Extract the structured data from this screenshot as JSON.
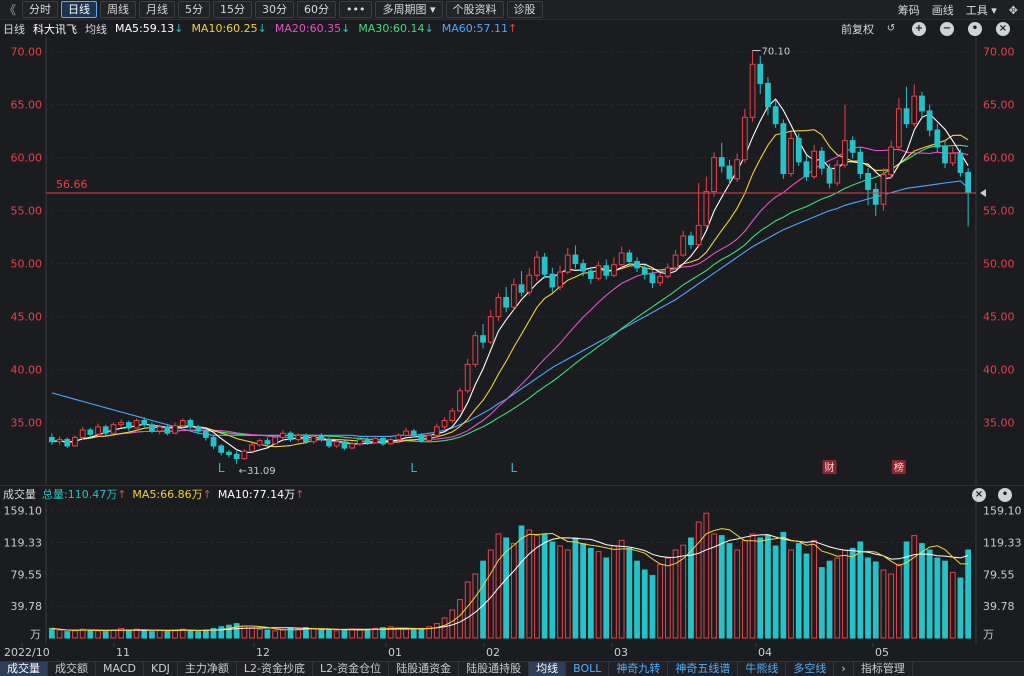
{
  "toolbar": {
    "back": "《",
    "tabs": [
      "分时",
      "日线",
      "周线",
      "月线",
      "5分",
      "15分",
      "30分",
      "60分",
      "•••",
      "多周期图 ▾",
      "个股资料",
      "诊股"
    ],
    "active_tab": 1,
    "right": [
      "筹码",
      "画线",
      "工具 ▾"
    ]
  },
  "info": {
    "period": "日线",
    "name": "科大讯飞",
    "ma_label": "均线",
    "ma5": "MA5:59.13",
    "ma10": "MA10:60.25",
    "ma20": "MA20:60.35",
    "ma30": "MA30:60.14",
    "ma60": "MA60:57.11",
    "ma5_dir": "↓",
    "ma10_dir": "↓",
    "ma20_dir": "↓",
    "ma30_dir": "↓",
    "ma60_dir": "↑",
    "adjust": "前复权"
  },
  "colors": {
    "up": "#e8414a",
    "down": "#25c3c8",
    "ma5": "#ffffff",
    "ma10": "#f2d13a",
    "ma20": "#e551c6",
    "ma30": "#3ddc7a",
    "ma60": "#4aa8ff",
    "price_line": "#e8414a"
  },
  "price_axis": {
    "ticks": [
      "70.00",
      "65.00",
      "60.00",
      "55.00",
      "50.00",
      "45.00",
      "40.00",
      "35.00"
    ],
    "min": 31,
    "max": 71
  },
  "annotations": {
    "high": "70.10",
    "low": "←31.09",
    "current_price": "56.66",
    "markers": [
      "L",
      "L",
      "L"
    ],
    "events": [
      "财",
      "榜"
    ]
  },
  "volume": {
    "title": "成交量",
    "total": "总量:110.47万",
    "total_dir": "↑",
    "ma5": "MA5:66.86万",
    "ma5_dir": "↑",
    "ma10": "MA10:77.14万",
    "ma10_dir": "↑",
    "ticks": [
      "159.10",
      "119.33",
      "79.55",
      "39.78"
    ],
    "unit": "万",
    "max": 160
  },
  "x_axis": [
    "2022/10",
    "11",
    "12",
    "01",
    "02",
    "03",
    "04",
    "05"
  ],
  "bottom_tabs": [
    "成交量",
    "成交额",
    "MACD",
    "KDJ",
    "主力净额",
    "L2-资金抄底",
    "L2-资金仓位",
    "陆股通资金",
    "陆股通持股",
    "均线",
    "BOLL",
    "神奇九转",
    "神奇五线谱",
    "牛熊线",
    "多空线",
    "›",
    "指标管理"
  ],
  "bottom_active": [
    0,
    9
  ],
  "chart_data": {
    "type": "candlestick",
    "title": "",
    "xlabel": "",
    "ylabel": "",
    "ylim": [
      31,
      71
    ],
    "candles": [
      [
        33.6,
        33.2,
        34.0,
        32.9
      ],
      [
        33.2,
        33.4,
        33.7,
        32.9
      ],
      [
        33.4,
        32.8,
        33.6,
        32.6
      ],
      [
        32.8,
        33.6,
        33.8,
        32.7
      ],
      [
        33.6,
        34.3,
        34.6,
        33.4
      ],
      [
        34.3,
        33.9,
        34.5,
        33.6
      ],
      [
        33.9,
        34.6,
        34.9,
        33.8
      ],
      [
        34.6,
        34.0,
        34.8,
        33.8
      ],
      [
        34.0,
        34.8,
        35.0,
        33.9
      ],
      [
        34.8,
        35.0,
        35.3,
        34.5
      ],
      [
        35.0,
        34.5,
        35.2,
        34.2
      ],
      [
        34.5,
        35.2,
        35.4,
        34.4
      ],
      [
        35.2,
        34.8,
        35.5,
        34.6
      ],
      [
        34.8,
        34.2,
        35.0,
        34.0
      ],
      [
        34.2,
        34.6,
        34.8,
        33.9
      ],
      [
        34.6,
        34.0,
        34.8,
        33.8
      ],
      [
        34.0,
        34.7,
        35.0,
        33.9
      ],
      [
        34.7,
        35.2,
        35.4,
        34.5
      ],
      [
        35.2,
        34.6,
        35.4,
        34.4
      ],
      [
        34.6,
        34.2,
        34.8,
        33.9
      ],
      [
        34.2,
        33.6,
        34.4,
        33.3
      ],
      [
        33.6,
        32.8,
        33.8,
        32.5
      ],
      [
        32.8,
        32.2,
        33.0,
        31.9
      ],
      [
        32.2,
        32.0,
        32.4,
        31.7
      ],
      [
        32.0,
        31.6,
        32.3,
        31.1
      ],
      [
        31.6,
        32.3,
        32.5,
        31.5
      ],
      [
        32.3,
        32.9,
        33.1,
        32.2
      ],
      [
        32.9,
        33.3,
        33.5,
        32.7
      ],
      [
        33.3,
        33.0,
        33.6,
        32.8
      ],
      [
        33.0,
        33.6,
        33.9,
        32.9
      ],
      [
        33.6,
        34.0,
        34.3,
        33.4
      ],
      [
        34.0,
        33.4,
        34.2,
        33.2
      ],
      [
        33.4,
        33.8,
        34.0,
        33.2
      ],
      [
        33.8,
        33.2,
        34.0,
        33.0
      ],
      [
        33.2,
        33.7,
        33.9,
        33.0
      ],
      [
        33.7,
        33.4,
        34.0,
        33.2
      ],
      [
        33.4,
        32.8,
        33.6,
        32.6
      ],
      [
        32.8,
        33.2,
        33.4,
        32.6
      ],
      [
        33.2,
        32.6,
        33.3,
        32.4
      ],
      [
        32.6,
        33.0,
        33.2,
        32.5
      ],
      [
        33.0,
        33.4,
        33.6,
        32.8
      ],
      [
        33.4,
        33.1,
        33.6,
        32.9
      ],
      [
        33.1,
        33.5,
        33.8,
        33.0
      ],
      [
        33.5,
        33.0,
        33.7,
        32.8
      ],
      [
        33.0,
        33.4,
        33.6,
        32.9
      ],
      [
        33.4,
        33.8,
        34.0,
        33.3
      ],
      [
        33.8,
        34.2,
        34.5,
        33.7
      ],
      [
        34.2,
        33.8,
        34.4,
        33.6
      ],
      [
        33.8,
        33.3,
        34.0,
        33.1
      ],
      [
        33.3,
        33.8,
        34.0,
        33.2
      ],
      [
        33.8,
        34.6,
        34.9,
        33.7
      ],
      [
        34.6,
        35.2,
        35.5,
        34.4
      ],
      [
        35.2,
        36.1,
        36.4,
        35.0
      ],
      [
        36.1,
        38.0,
        38.3,
        36.0
      ],
      [
        38.0,
        40.5,
        41.0,
        37.8
      ],
      [
        40.5,
        43.2,
        43.6,
        40.2
      ],
      [
        43.2,
        42.6,
        44.3,
        42.0
      ],
      [
        42.6,
        45.0,
        45.6,
        42.4
      ],
      [
        45.0,
        46.8,
        47.2,
        44.6
      ],
      [
        46.8,
        45.9,
        47.8,
        45.4
      ],
      [
        45.9,
        48.0,
        48.6,
        45.6
      ],
      [
        48.0,
        47.3,
        49.3,
        46.9
      ],
      [
        47.3,
        48.9,
        49.6,
        47.0
      ],
      [
        48.9,
        50.6,
        51.2,
        48.4
      ],
      [
        50.6,
        49.0,
        51.0,
        48.6
      ],
      [
        49.0,
        47.8,
        49.6,
        47.3
      ],
      [
        47.8,
        49.2,
        49.8,
        47.5
      ],
      [
        49.2,
        50.8,
        51.5,
        49.0
      ],
      [
        50.8,
        50.0,
        51.7,
        49.5
      ],
      [
        50.0,
        49.3,
        50.4,
        48.8
      ],
      [
        49.3,
        48.6,
        49.7,
        48.1
      ],
      [
        48.6,
        49.8,
        50.2,
        48.4
      ],
      [
        49.8,
        48.9,
        50.4,
        48.5
      ],
      [
        48.9,
        49.9,
        50.6,
        48.7
      ],
      [
        49.9,
        51.0,
        51.6,
        49.6
      ],
      [
        51.0,
        50.2,
        51.3,
        49.8
      ],
      [
        50.2,
        49.6,
        50.6,
        49.2
      ],
      [
        49.6,
        49.0,
        49.9,
        48.5
      ],
      [
        49.0,
        48.2,
        49.3,
        47.7
      ],
      [
        48.2,
        48.8,
        49.1,
        47.9
      ],
      [
        48.8,
        49.6,
        50.0,
        48.6
      ],
      [
        49.6,
        50.8,
        51.3,
        49.4
      ],
      [
        50.8,
        52.6,
        53.1,
        50.6
      ],
      [
        52.6,
        51.8,
        53.0,
        51.4
      ],
      [
        51.8,
        53.6,
        57.6,
        51.5
      ],
      [
        53.6,
        56.8,
        58.2,
        53.4
      ],
      [
        56.8,
        60.0,
        60.5,
        56.3
      ],
      [
        60.0,
        59.2,
        61.4,
        58.6
      ],
      [
        59.2,
        58.0,
        59.8,
        57.4
      ],
      [
        58.0,
        59.8,
        60.4,
        57.7
      ],
      [
        59.8,
        63.8,
        64.6,
        59.5
      ],
      [
        63.8,
        68.8,
        70.1,
        63.4
      ],
      [
        68.8,
        67.0,
        69.6,
        66.0
      ],
      [
        67.0,
        64.8,
        67.6,
        64.0
      ],
      [
        64.8,
        63.2,
        65.4,
        62.8
      ],
      [
        63.2,
        58.5,
        63.6,
        58.0
      ],
      [
        58.5,
        61.8,
        62.4,
        58.2
      ],
      [
        61.8,
        59.6,
        62.3,
        59.2
      ],
      [
        59.6,
        58.2,
        60.2,
        57.8
      ],
      [
        58.2,
        60.6,
        61.2,
        58.0
      ],
      [
        60.6,
        59.0,
        61.0,
        58.4
      ],
      [
        59.0,
        57.6,
        59.4,
        57.1
      ],
      [
        57.6,
        59.3,
        59.8,
        57.3
      ],
      [
        59.3,
        61.6,
        65.0,
        59.0
      ],
      [
        61.6,
        60.5,
        62.0,
        59.9
      ],
      [
        60.5,
        58.5,
        61.0,
        58.0
      ],
      [
        58.5,
        57.0,
        59.0,
        55.5
      ],
      [
        57.0,
        55.6,
        57.6,
        54.5
      ],
      [
        55.6,
        58.4,
        59.0,
        55.0
      ],
      [
        58.4,
        61.0,
        61.6,
        58.0
      ],
      [
        61.0,
        64.6,
        65.6,
        60.6
      ],
      [
        64.6,
        63.2,
        66.7,
        62.8
      ],
      [
        63.2,
        65.8,
        66.9,
        62.9
      ],
      [
        65.8,
        64.4,
        66.2,
        63.8
      ],
      [
        64.4,
        62.6,
        65.0,
        62.0
      ],
      [
        62.6,
        61.0,
        63.2,
        60.5
      ],
      [
        61.0,
        59.5,
        61.6,
        59.0
      ],
      [
        59.5,
        60.4,
        61.0,
        59.2
      ],
      [
        60.4,
        58.6,
        60.8,
        58.2
      ],
      [
        58.6,
        56.66,
        59.0,
        53.5
      ]
    ],
    "volume": [
      12,
      10,
      8,
      9,
      11,
      10,
      9,
      8,
      10,
      12,
      10,
      11,
      9,
      8,
      10,
      9,
      10,
      11,
      9,
      8,
      10,
      12,
      14,
      16,
      18,
      15,
      12,
      11,
      10,
      9,
      10,
      12,
      11,
      13,
      12,
      11,
      10,
      9,
      10,
      11,
      10,
      11,
      12,
      13,
      14,
      12,
      11,
      10,
      12,
      14,
      18,
      25,
      35,
      48,
      70,
      80,
      96,
      110,
      130,
      125,
      118,
      140,
      135,
      128,
      130,
      120,
      115,
      110,
      125,
      118,
      112,
      108,
      100,
      115,
      122,
      112,
      96,
      85,
      78,
      92,
      100,
      110,
      116,
      125,
      145,
      156,
      130,
      128,
      118,
      110,
      122,
      130,
      125,
      128,
      115,
      132,
      110,
      118,
      105,
      122,
      88,
      96,
      100,
      110,
      112,
      120,
      100,
      95,
      85,
      80,
      92,
      120,
      128,
      118,
      110,
      100,
      96,
      82,
      75,
      110
    ],
    "ma60": [
      37.8,
      37.6,
      37.4,
      37.2,
      37.0,
      36.8,
      36.6,
      36.4,
      36.2,
      36.0,
      35.8,
      35.6,
      35.4,
      35.2,
      35.0,
      34.8,
      34.6,
      34.4,
      34.2,
      34.0,
      33.9,
      33.8,
      33.8,
      33.8,
      33.8,
      33.8,
      33.8,
      33.8,
      33.8,
      33.8,
      33.8,
      33.8,
      33.8,
      33.8,
      33.8,
      33.8,
      33.8,
      33.8,
      33.8,
      33.8,
      33.7,
      33.7,
      33.7,
      33.7,
      33.7,
      33.8,
      33.8,
      33.8,
      33.9,
      34.0,
      34.1,
      34.3,
      34.5,
      34.8,
      35.1,
      35.5,
      35.9,
      36.3,
      36.8,
      37.2,
      37.7,
      38.2,
      38.7,
      39.2,
      39.7,
      40.2,
      40.6,
      41.0,
      41.4,
      41.8,
      42.2,
      42.6,
      43.0,
      43.4,
      43.8,
      44.2,
      44.6,
      45.0,
      45.4,
      45.8,
      46.2,
      46.6,
      47.1,
      47.6,
      48.1,
      48.6,
      49.1,
      49.6,
      50.1,
      50.6,
      51.1,
      51.6,
      52.0,
      52.4,
      52.8,
      53.2,
      53.5,
      53.8,
      54.1,
      54.4,
      54.7,
      55.0,
      55.2,
      55.5,
      55.7,
      55.9,
      56.1,
      56.3,
      56.5,
      56.7,
      56.9,
      57.1,
      57.2,
      57.3,
      57.4,
      57.5,
      57.6,
      57.7,
      57.8,
      57.11
    ]
  }
}
